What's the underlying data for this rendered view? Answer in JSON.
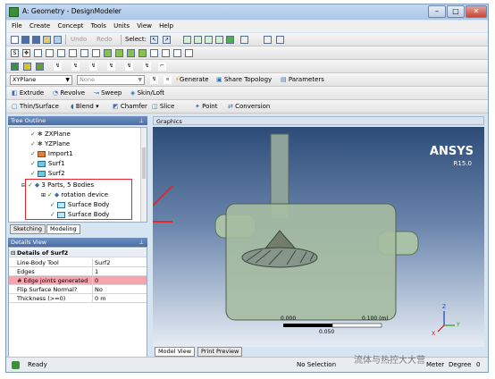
{
  "window": {
    "title": "A: Geometry - DesignModeler"
  },
  "menu": [
    "File",
    "Create",
    "Concept",
    "Tools",
    "Units",
    "View",
    "Help"
  ],
  "toolbar1": {
    "undo": "Undo",
    "redo": "Redo",
    "select": "Select:"
  },
  "toolbar3": {
    "plane": "XYPlane",
    "sketch": "None",
    "generate": "Generate",
    "share_topology": "Share Topology",
    "parameters": "Parameters"
  },
  "toolbar4": {
    "extrude": "Extrude",
    "revolve": "Revolve",
    "sweep": "Sweep",
    "skin_loft": "Skin/Loft"
  },
  "toolbar5": {
    "thin_surface": "Thin/Surface",
    "blend": "Blend",
    "chamfer": "Chamfer",
    "slice": "Slice",
    "point": "Point",
    "conversion": "Conversion"
  },
  "tree": {
    "title": "Tree Outline",
    "items": [
      "ZXPlane",
      "YZPlane",
      "Import1",
      "Surf1",
      "Surf2",
      "3 Parts, 5 Bodies",
      "rotation device",
      "Surface Body",
      "Surface Body"
    ]
  },
  "tabs": {
    "sketching": "Sketching",
    "modeling": "Modeling"
  },
  "details": {
    "title": "Details View",
    "section": "Details of Surf2",
    "rows": [
      {
        "key": "Line-Body Tool",
        "value": "Surf2"
      },
      {
        "key": "Edges",
        "value": "1"
      },
      {
        "key": "# Edge joints generated",
        "value": "0"
      },
      {
        "key": "Flip Surface Normal?",
        "value": "No"
      },
      {
        "key": "Thickness (>=0)",
        "value": "0 m"
      }
    ]
  },
  "graphics": {
    "title": "Graphics",
    "brand": "ANSYS",
    "version": "R15.0",
    "scale_0": "0.000",
    "scale_mid": "0.050",
    "scale_max": "0.100 (m)",
    "axis_x": "X",
    "axis_y": "Y",
    "axis_z": "Z"
  },
  "view_tabs": {
    "model_view": "Model View",
    "print_preview": "Print Preview"
  },
  "status": {
    "ready": "Ready",
    "selection": "No Selection",
    "units": "Meter",
    "angle": "Degree",
    "value": "0"
  },
  "watermark": "流体与热控大大营",
  "colors": {
    "highlight_row": "#f7a3b0",
    "annotation_red": "#e8262a",
    "panel_header": "#4a6ea6"
  }
}
